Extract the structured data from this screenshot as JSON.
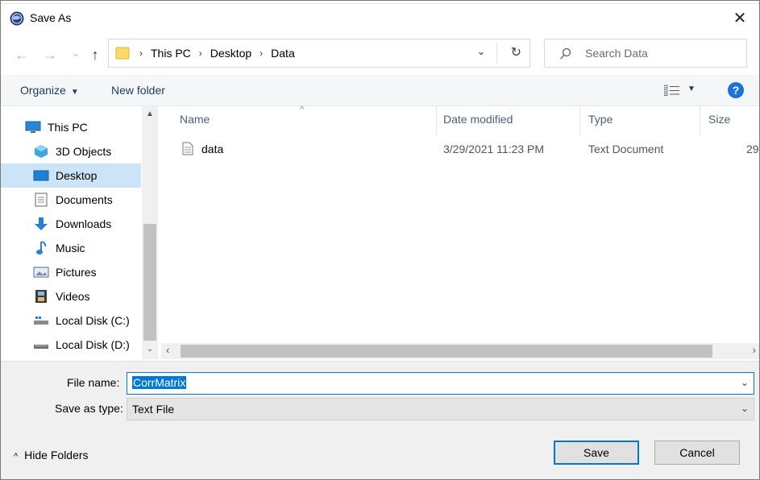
{
  "window": {
    "title": "Save As",
    "close_glyph": "✕"
  },
  "nav_buttons": {
    "back": "←",
    "forward": "→",
    "recent": "⌄",
    "up": "↑"
  },
  "address": {
    "crumbs": [
      "This PC",
      "Desktop",
      "Data"
    ],
    "separator": "›",
    "dropdown": "⌄",
    "refresh": "↻"
  },
  "search": {
    "placeholder": "Search Data"
  },
  "commands": {
    "organize": "Organize",
    "new_folder": "New folder",
    "caret": "▼"
  },
  "sidebar": {
    "items": [
      {
        "label": "This PC",
        "icon": "monitor-icon"
      },
      {
        "label": "3D Objects",
        "icon": "cube-icon"
      },
      {
        "label": "Desktop",
        "icon": "desktop-icon",
        "selected": true
      },
      {
        "label": "Documents",
        "icon": "document-icon"
      },
      {
        "label": "Downloads",
        "icon": "download-icon"
      },
      {
        "label": "Music",
        "icon": "music-note-icon"
      },
      {
        "label": "Pictures",
        "icon": "picture-icon"
      },
      {
        "label": "Videos",
        "icon": "film-icon"
      },
      {
        "label": "Local Disk (C:)",
        "icon": "drive-icon"
      },
      {
        "label": "Local Disk (D:)",
        "icon": "drive-icon"
      }
    ]
  },
  "file_list": {
    "columns": [
      "Name",
      "Date modified",
      "Type",
      "Size"
    ],
    "rows": [
      {
        "name": "data",
        "date": "3/29/2021 11:23 PM",
        "type": "Text Document",
        "size": "29"
      }
    ]
  },
  "form": {
    "file_name_label": "File name:",
    "file_name_value": "CorrMatrix",
    "save_type_label": "Save as type:",
    "save_type_value": "Text File"
  },
  "footer": {
    "hide_folders": "Hide Folders",
    "save": "Save",
    "cancel": "Cancel"
  },
  "colors": {
    "accent": "#0078d7",
    "selected_bg": "#cce4f7",
    "help_blue": "#1a73d9"
  }
}
